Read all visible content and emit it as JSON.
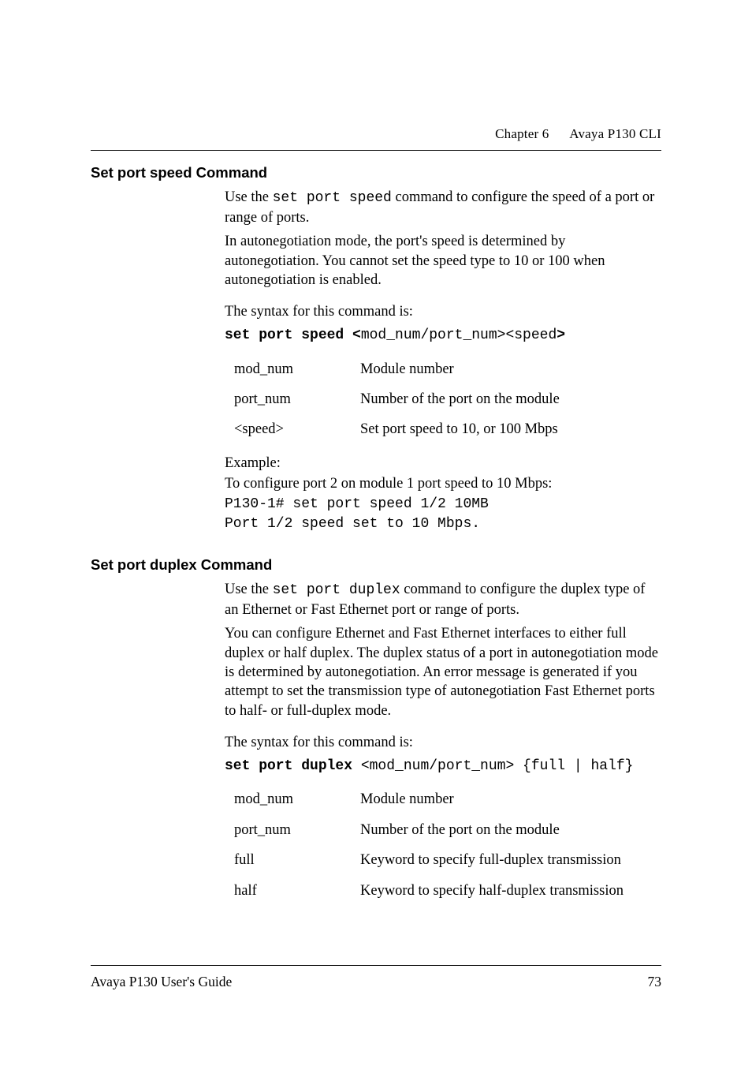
{
  "header": {
    "chapter": "Chapter 6",
    "title": "Avaya P130 CLI"
  },
  "sections": [
    {
      "title": "Set port speed Command",
      "intro": [
        {
          "pre": "Use the ",
          "code": "set port speed",
          "post": " command to configure the speed of a port or range of ports."
        },
        {
          "text": "In autonegotiation mode, the port's speed is determined by autonegotiation. You cannot set the speed type to 10 or 100 when autonegotiation is enabled."
        }
      ],
      "syntax_label": "The syntax for this command is:",
      "syntax": {
        "cmd": "set port speed <",
        "args": "mod_num/port_num><speed",
        "tail": ">"
      },
      "defs": [
        {
          "term": "mod_num",
          "desc": "Module number"
        },
        {
          "term": "port_num",
          "desc": "Number of the port on the module"
        },
        {
          "term": "<speed>",
          "desc": "Set port speed to 10, or 100 Mbps"
        }
      ],
      "example_label": "Example:",
      "example_intro": "To configure port 2 on module 1 port speed to 10 Mbps:",
      "example_lines": [
        "P130-1# set port speed 1/2 10MB",
        "Port 1/2 speed set to 10 Mbps."
      ]
    },
    {
      "title": "Set port duplex Command",
      "intro": [
        {
          "pre": "Use the ",
          "code": "set port duplex",
          "post": " command to configure the duplex type of an Ethernet or Fast Ethernet port or range of ports."
        },
        {
          "text": "You can configure Ethernet and Fast Ethernet interfaces to either full duplex or half duplex. The duplex status of a port in autonegotiation mode is determined by autonegotiation. An error message is generated if you attempt to set the transmission type of autonegotiation Fast Ethernet ports to half- or full-duplex mode."
        }
      ],
      "syntax_label": "The syntax for this command is:",
      "syntax": {
        "cmd": "set port duplex ",
        "args": "<mod_num/port_num> {full | half}",
        "tail": ""
      },
      "defs": [
        {
          "term": "mod_num",
          "desc": "Module number"
        },
        {
          "term": "port_num",
          "desc": "Number of the port on the module"
        },
        {
          "term": "full",
          "desc": "Keyword to specify full-duplex transmission"
        },
        {
          "term": "half",
          "desc": "Keyword to specify half-duplex transmission"
        }
      ]
    }
  ],
  "footer": {
    "left": "Avaya P130 User's Guide",
    "right": "73"
  }
}
